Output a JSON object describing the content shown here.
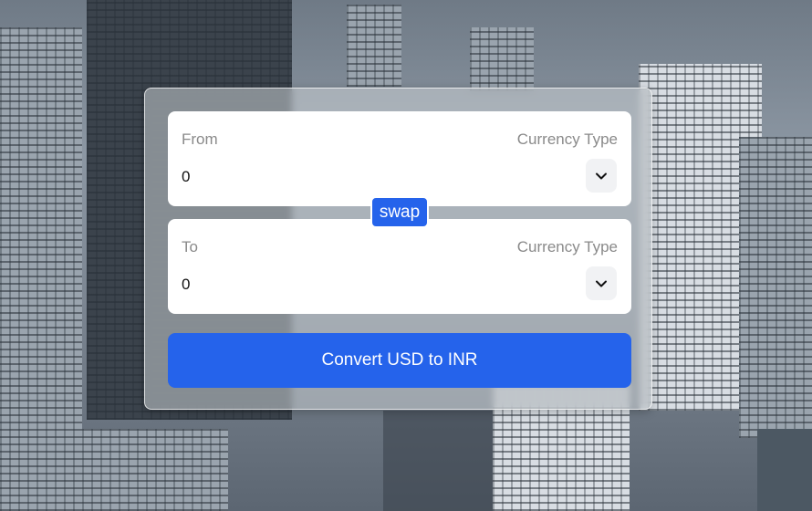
{
  "from": {
    "label": "From",
    "currency_label": "Currency Type",
    "amount": "0",
    "select_icon": "chevron-down-icon"
  },
  "swap": {
    "label": "swap"
  },
  "to": {
    "label": "To",
    "currency_label": "Currency Type",
    "amount": "0",
    "select_icon": "chevron-down-icon"
  },
  "convert": {
    "label": "Convert USD to INR"
  },
  "colors": {
    "accent": "#2563eb",
    "panel": "#ffffff",
    "label": "#8a8a8a"
  }
}
